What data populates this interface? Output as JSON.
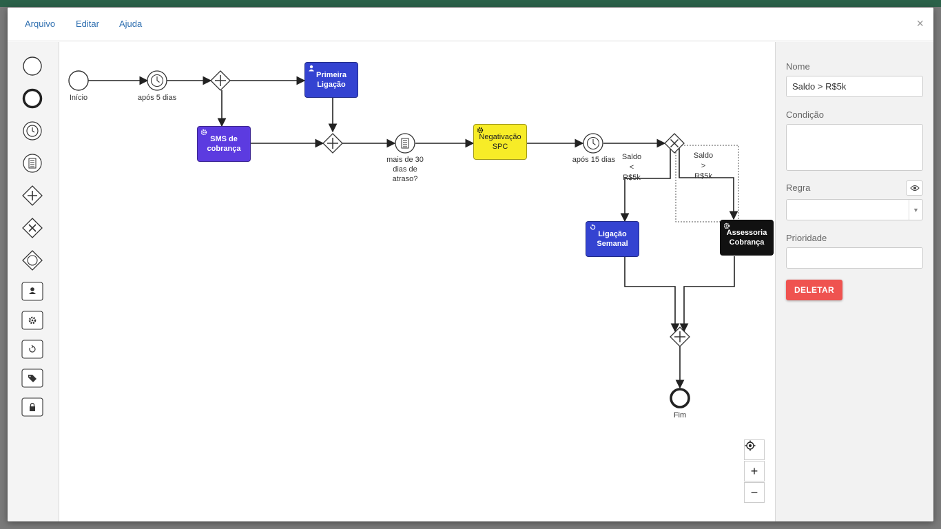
{
  "menu": {
    "file": "Arquivo",
    "edit": "Editar",
    "help": "Ajuda",
    "close": "×"
  },
  "colors": {
    "user_task": "#3443d1",
    "service_task": "#5c3be0",
    "yellow_task": "#f7ec27",
    "black_task": "#111111",
    "delete": "#ef5350",
    "menu_link": "#2f6fb0"
  },
  "palette": [
    "start-event",
    "end-event",
    "timer-event",
    "conditional-event",
    "parallel-gateway",
    "exclusive-gateway",
    "event-based-gateway",
    "user-task",
    "service-task",
    "loop-task",
    "tag-task",
    "lock-task"
  ],
  "diagram": {
    "start_label": "Início",
    "timer1_label": "após 5 dias",
    "task_primeira": "Primeira Ligação",
    "task_sms": "SMS de cobrança",
    "condition_label": "mais de 30 dias de atraso?",
    "task_negativacao": "Negativação SPC",
    "timer2_label": "após 15 dias",
    "edge_lt": "Saldo < R$5k",
    "edge_gt": "Saldo > R$5k",
    "task_ligacao": "Ligação Semanal",
    "task_assessoria": "Assessoria Cobrança",
    "end_label": "Fim"
  },
  "zoom": {
    "zoom_in": "+",
    "zoom_out": "−"
  },
  "properties": {
    "name_label": "Nome",
    "name_value": "Saldo > R$5k",
    "condition_label": "Condição",
    "condition_value": "",
    "rule_label": "Regra",
    "rule_value": "",
    "priority_label": "Prioridade",
    "priority_value": "",
    "delete_label": "DELETAR"
  }
}
